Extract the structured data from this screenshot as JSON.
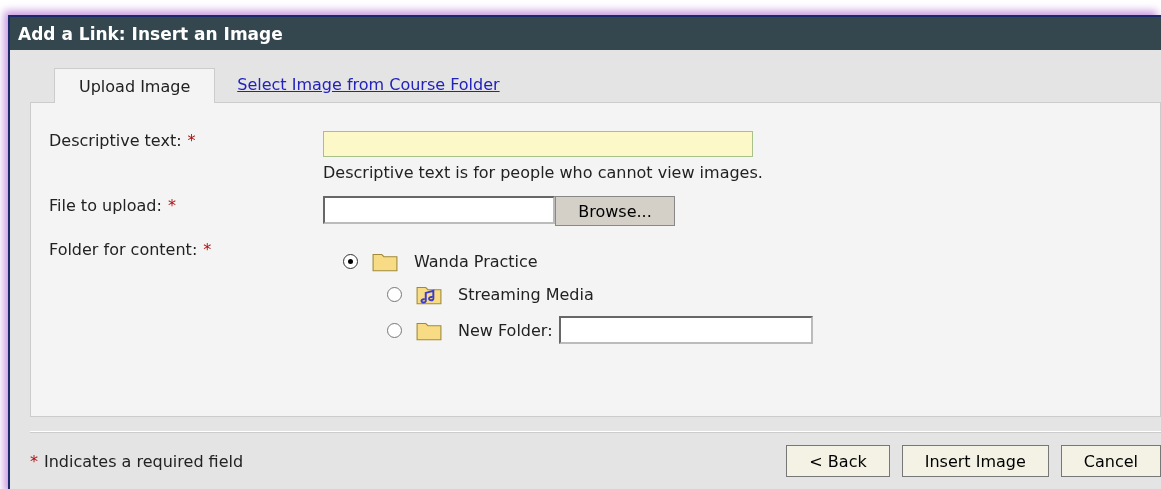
{
  "window": {
    "title": "Add a Link: Insert an Image"
  },
  "tabs": [
    {
      "label": "Upload Image",
      "selected": true
    },
    {
      "label": "Select Image from Course Folder",
      "selected": false
    }
  ],
  "fields": [
    {
      "label": "Descriptive text:",
      "required_mark": "*",
      "kind": "text",
      "hint": "Descriptive text is for people who cannot view images."
    },
    {
      "label": "File to upload:",
      "required_mark": "*",
      "kind": "file",
      "button": "Browse..."
    },
    {
      "label": "Folder for content:",
      "required_mark": "*",
      "kind": "folders"
    }
  ],
  "folders": [
    {
      "name": "Wanda Practice",
      "kind": "folder",
      "selected": true,
      "children": [
        {
          "name": "Streaming Media",
          "kind": "media",
          "selected": false
        },
        {
          "name": "New Folder:",
          "kind": "new",
          "selected": false
        }
      ]
    }
  ],
  "footer": {
    "mark": "*",
    "note": "Indicates a required field"
  },
  "buttons": [
    "< Back",
    "Insert Image",
    "Cancel"
  ]
}
